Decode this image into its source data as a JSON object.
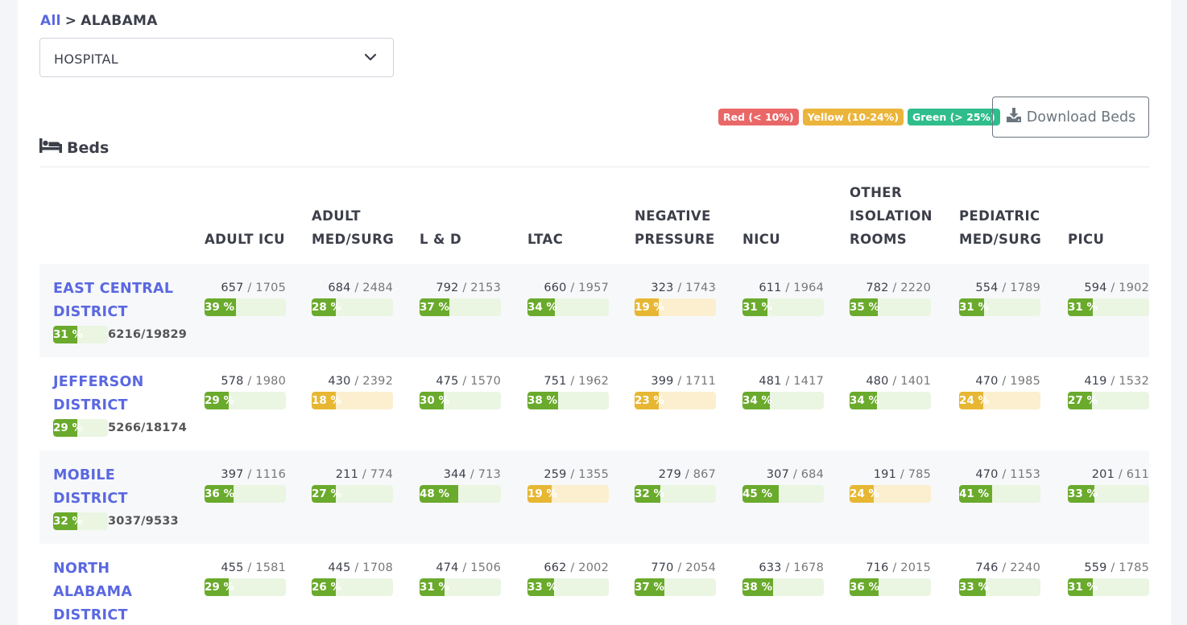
{
  "breadcrumb": {
    "root": "All",
    "separator": ">",
    "current": "ALABAMA"
  },
  "facility_select": {
    "value": "HOSPITAL"
  },
  "legend": [
    {
      "label": "Red (< 10%)",
      "color": "#ea6767"
    },
    {
      "label": "Yellow (10-24%)",
      "color": "#ebb43a"
    },
    {
      "label": "Green (> 25%)",
      "color": "#2fbd8c"
    }
  ],
  "download_label": "Download Beds",
  "section_title": "Beds",
  "colors": {
    "green_fill": "#6aaa2c",
    "green_track": "#eaf5e2",
    "yellow_fill": "#e7b734",
    "yellow_track": "#fbefcf",
    "link": "#5a68e0"
  },
  "columns": [
    {
      "label": "ADULT ICU"
    },
    {
      "label": "ADULT MED/SURG"
    },
    {
      "label": "L & D"
    },
    {
      "label": "LTAC"
    },
    {
      "label": "NEGATIVE PRESSURE"
    },
    {
      "label": "NICU"
    },
    {
      "label": "OTHER ISOLATION ROOMS"
    },
    {
      "label": "PEDIATRIC MED/SURG"
    },
    {
      "label": "PICU"
    }
  ],
  "rows": [
    {
      "name": "EAST CENTRAL DISTRICT",
      "summary": {
        "pct": 31,
        "pct_label": "31 %",
        "total": "6216/19829",
        "level": "green"
      },
      "cells": [
        {
          "avail": "657",
          "total": "1705",
          "pct": 39,
          "pct_label": "39 %",
          "level": "green"
        },
        {
          "avail": "684",
          "total": "2484",
          "pct": 28,
          "pct_label": "28 %",
          "level": "green"
        },
        {
          "avail": "792",
          "total": "2153",
          "pct": 37,
          "pct_label": "37 %",
          "level": "green"
        },
        {
          "avail": "660",
          "total": "1957",
          "pct": 34,
          "pct_label": "34 %",
          "level": "green"
        },
        {
          "avail": "323",
          "total": "1743",
          "pct": 19,
          "pct_label": "19 %",
          "level": "yellow"
        },
        {
          "avail": "611",
          "total": "1964",
          "pct": 31,
          "pct_label": "31 %",
          "level": "green"
        },
        {
          "avail": "782",
          "total": "2220",
          "pct": 35,
          "pct_label": "35 %",
          "level": "green"
        },
        {
          "avail": "554",
          "total": "1789",
          "pct": 31,
          "pct_label": "31 %",
          "level": "green"
        },
        {
          "avail": "594",
          "total": "1902",
          "pct": 31,
          "pct_label": "31 %",
          "level": "green"
        }
      ]
    },
    {
      "name": "JEFFERSON DISTRICT",
      "summary": {
        "pct": 29,
        "pct_label": "29 %",
        "total": "5266/18174",
        "level": "green"
      },
      "cells": [
        {
          "avail": "578",
          "total": "1980",
          "pct": 29,
          "pct_label": "29 %",
          "level": "green"
        },
        {
          "avail": "430",
          "total": "2392",
          "pct": 18,
          "pct_label": "18 %",
          "level": "yellow"
        },
        {
          "avail": "475",
          "total": "1570",
          "pct": 30,
          "pct_label": "30 %",
          "level": "green"
        },
        {
          "avail": "751",
          "total": "1962",
          "pct": 38,
          "pct_label": "38 %",
          "level": "green"
        },
        {
          "avail": "399",
          "total": "1711",
          "pct": 23,
          "pct_label": "23 %",
          "level": "yellow"
        },
        {
          "avail": "481",
          "total": "1417",
          "pct": 34,
          "pct_label": "34 %",
          "level": "green"
        },
        {
          "avail": "480",
          "total": "1401",
          "pct": 34,
          "pct_label": "34 %",
          "level": "green"
        },
        {
          "avail": "470",
          "total": "1985",
          "pct": 24,
          "pct_label": "24 %",
          "level": "yellow"
        },
        {
          "avail": "419",
          "total": "1532",
          "pct": 27,
          "pct_label": "27 %",
          "level": "green"
        }
      ]
    },
    {
      "name": "MOBILE DISTRICT",
      "summary": {
        "pct": 32,
        "pct_label": "32 %",
        "total": "3037/9533",
        "level": "green"
      },
      "cells": [
        {
          "avail": "397",
          "total": "1116",
          "pct": 36,
          "pct_label": "36 %",
          "level": "green"
        },
        {
          "avail": "211",
          "total": "774",
          "pct": 27,
          "pct_label": "27 %",
          "level": "green"
        },
        {
          "avail": "344",
          "total": "713",
          "pct": 48,
          "pct_label": "48 %",
          "level": "green"
        },
        {
          "avail": "259",
          "total": "1355",
          "pct": 19,
          "pct_label": "19 %",
          "level": "yellow"
        },
        {
          "avail": "279",
          "total": "867",
          "pct": 32,
          "pct_label": "32 %",
          "level": "green"
        },
        {
          "avail": "307",
          "total": "684",
          "pct": 45,
          "pct_label": "45 %",
          "level": "green"
        },
        {
          "avail": "191",
          "total": "785",
          "pct": 24,
          "pct_label": "24 %",
          "level": "yellow"
        },
        {
          "avail": "470",
          "total": "1153",
          "pct": 41,
          "pct_label": "41 %",
          "level": "green"
        },
        {
          "avail": "201",
          "total": "611",
          "pct": 33,
          "pct_label": "33 %",
          "level": "green"
        }
      ]
    },
    {
      "name": "NORTH ALABAMA DISTRICT",
      "summary": null,
      "cells": [
        {
          "avail": "455",
          "total": "1581",
          "pct": 29,
          "pct_label": "29 %",
          "level": "green"
        },
        {
          "avail": "445",
          "total": "1708",
          "pct": 26,
          "pct_label": "26 %",
          "level": "green"
        },
        {
          "avail": "474",
          "total": "1506",
          "pct": 31,
          "pct_label": "31 %",
          "level": "green"
        },
        {
          "avail": "662",
          "total": "2002",
          "pct": 33,
          "pct_label": "33 %",
          "level": "green"
        },
        {
          "avail": "770",
          "total": "2054",
          "pct": 37,
          "pct_label": "37 %",
          "level": "green"
        },
        {
          "avail": "633",
          "total": "1678",
          "pct": 38,
          "pct_label": "38 %",
          "level": "green"
        },
        {
          "avail": "716",
          "total": "2015",
          "pct": 36,
          "pct_label": "36 %",
          "level": "green"
        },
        {
          "avail": "746",
          "total": "2240",
          "pct": 33,
          "pct_label": "33 %",
          "level": "green"
        },
        {
          "avail": "559",
          "total": "1785",
          "pct": 31,
          "pct_label": "31 %",
          "level": "green"
        }
      ]
    }
  ]
}
